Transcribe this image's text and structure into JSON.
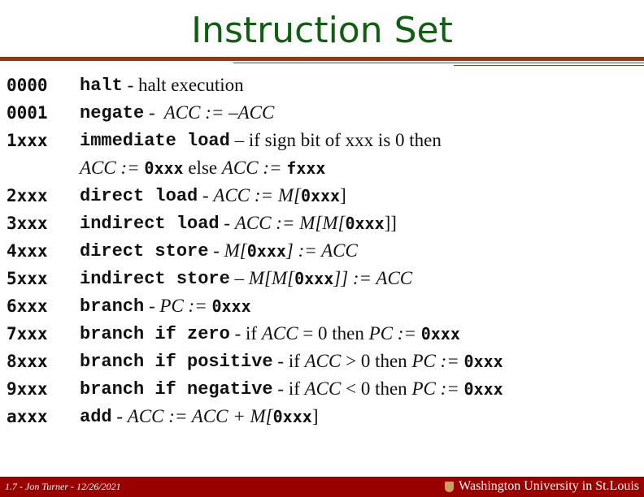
{
  "title": "Instruction Set",
  "instructions": [
    {
      "code": "0000",
      "name": "halt",
      "sep": " - ",
      "desc": [
        {
          "t": "halt execution",
          "s": "n"
        }
      ]
    },
    {
      "code": "0001",
      "name": "negate",
      "sep": " - ",
      "desc": [
        {
          "t": " ACC := –ACC",
          "s": "i"
        }
      ]
    },
    {
      "code": "1xxx",
      "name": "immediate load",
      "sep": " – ",
      "desc": [
        {
          "t": "if sign bit of xxx is 0 then",
          "s": "n"
        }
      ]
    },
    {
      "code": "",
      "name": "",
      "sep": "",
      "desc": [
        {
          "t": "ACC := ",
          "s": "i"
        },
        {
          "t": "0xxx",
          "s": "m"
        },
        {
          "t": " else ",
          "s": "n"
        },
        {
          "t": "ACC := ",
          "s": "i"
        },
        {
          "t": "fxxx",
          "s": "m"
        }
      ]
    },
    {
      "code": "2xxx",
      "name": "direct load",
      "sep": " - ",
      "desc": [
        {
          "t": "ACC := M[",
          "s": "i"
        },
        {
          "t": "0xxx",
          "s": "m"
        },
        {
          "t": "]",
          "s": "n"
        }
      ]
    },
    {
      "code": "3xxx",
      "name": "indirect load",
      "sep": " - ",
      "desc": [
        {
          "t": "ACC := M[M[",
          "s": "i"
        },
        {
          "t": "0xxx",
          "s": "m"
        },
        {
          "t": "]]",
          "s": "n"
        }
      ]
    },
    {
      "code": "4xxx",
      "name": "direct store",
      "sep": " - ",
      "desc": [
        {
          "t": "M[",
          "s": "i"
        },
        {
          "t": "0xxx",
          "s": "m"
        },
        {
          "t": "] := ACC",
          "s": "i"
        }
      ]
    },
    {
      "code": "5xxx",
      "name": "indirect store",
      "sep": " – ",
      "desc": [
        {
          "t": "M[M[",
          "s": "i"
        },
        {
          "t": "0xxx",
          "s": "m"
        },
        {
          "t": "]] := ACC",
          "s": "i"
        }
      ]
    },
    {
      "code": "6xxx",
      "name": "branch",
      "sep": " - ",
      "desc": [
        {
          "t": "PC := ",
          "s": "i"
        },
        {
          "t": "0xxx",
          "s": "m"
        }
      ]
    },
    {
      "code": "7xxx",
      "name": "branch if zero",
      "sep": " - ",
      "desc": [
        {
          "t": "if ",
          "s": "n"
        },
        {
          "t": "ACC",
          "s": "i"
        },
        {
          "t": " = 0 then ",
          "s": "n"
        },
        {
          "t": "PC := ",
          "s": "i"
        },
        {
          "t": "0xxx",
          "s": "m"
        }
      ]
    },
    {
      "code": "8xxx",
      "name": "branch if positive",
      "sep": " - ",
      "desc": [
        {
          "t": "if ",
          "s": "n"
        },
        {
          "t": "ACC",
          "s": "i"
        },
        {
          "t": " > 0 then ",
          "s": "n"
        },
        {
          "t": "PC := ",
          "s": "i"
        },
        {
          "t": "0xxx",
          "s": "m"
        }
      ]
    },
    {
      "code": "9xxx",
      "name": "branch if negative",
      "sep": " - ",
      "desc": [
        {
          "t": "if ",
          "s": "n"
        },
        {
          "t": "ACC",
          "s": "i"
        },
        {
          "t": " < 0 then ",
          "s": "n"
        },
        {
          "t": "PC := ",
          "s": "i"
        },
        {
          "t": "0xxx",
          "s": "m"
        }
      ]
    },
    {
      "code": "axxx",
      "name": "add",
      "sep": " - ",
      "desc": [
        {
          "t": "ACC := ACC + M[",
          "s": "i"
        },
        {
          "t": "0xxx",
          "s": "m"
        },
        {
          "t": "]",
          "s": "n"
        }
      ]
    }
  ],
  "footer": {
    "left": "1.7 - Jon Turner - 12/26/2021",
    "right": "Washington University in St.Louis",
    "logo_icon": "university-shield-icon"
  },
  "colors": {
    "title": "#0f5e12",
    "rule": "#8b3a1a",
    "footer_bg": "#990000"
  }
}
